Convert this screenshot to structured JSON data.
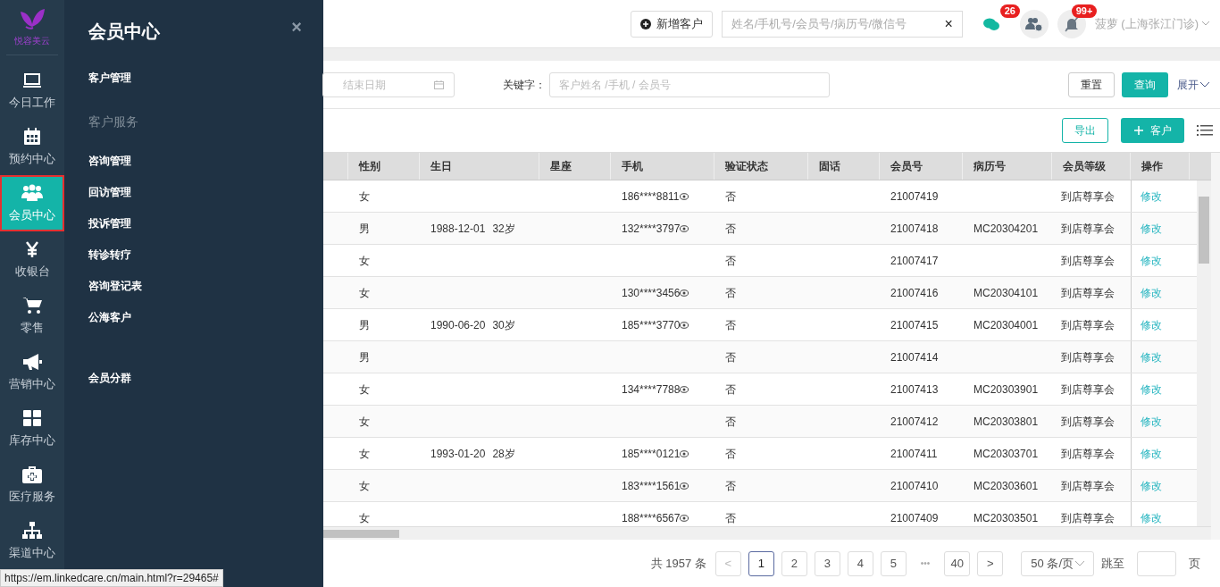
{
  "logo": {
    "text": "悦容美云"
  },
  "nav": [
    {
      "label": "今日工作",
      "selected": false
    },
    {
      "label": "预约中心",
      "selected": false
    },
    {
      "label": "会员中心",
      "selected": true
    },
    {
      "label": "收银台",
      "selected": false
    },
    {
      "label": "零售",
      "selected": false
    },
    {
      "label": "营销中心",
      "selected": false
    },
    {
      "label": "库存中心",
      "selected": false
    },
    {
      "label": "医疗服务",
      "selected": false
    },
    {
      "label": "渠道中心",
      "selected": false
    }
  ],
  "flyout": {
    "title": "会员中心",
    "close": "×",
    "items": [
      {
        "kind": "link",
        "label": "客户管理"
      },
      {
        "kind": "group",
        "label": "客户服务"
      },
      {
        "kind": "link",
        "label": "咨询管理"
      },
      {
        "kind": "link",
        "label": "回访管理"
      },
      {
        "kind": "link",
        "label": "投诉管理"
      },
      {
        "kind": "link",
        "label": "转诊转疗"
      },
      {
        "kind": "link",
        "label": "咨询登记表"
      },
      {
        "kind": "link",
        "label": "公海客户"
      },
      {
        "kind": "spacer"
      },
      {
        "kind": "link",
        "label": "会员分群"
      }
    ]
  },
  "header": {
    "add_button": "新增客户",
    "search": {
      "placeholder": "姓名/手机号/会员号/病历号/微信号",
      "clear": "×"
    },
    "wechat_badge": "26",
    "bell_badge": "99+",
    "user": "菠萝 (上海张江门诊)"
  },
  "filter": {
    "end_date_placeholder": "结束日期",
    "keyword_label": "关键字：",
    "keyword_placeholder": "客户姓名 /手机 / 会员号",
    "reset": "重置",
    "query": "查询",
    "expand": "展开"
  },
  "toolbar": {
    "export": "导出",
    "add": "客户"
  },
  "table": {
    "columns": [
      "性别",
      "生日",
      "星座",
      "手机",
      "验证状态",
      "固话",
      "会员号",
      "病历号",
      "会员等级",
      "操作"
    ],
    "rows": [
      {
        "gender": "女",
        "birthday": "",
        "age": "",
        "phone": "186****8811",
        "verified": "否",
        "member_no": "21007419",
        "record_no": "",
        "level": "到店尊享会",
        "action": "修改"
      },
      {
        "gender": "男",
        "birthday": "1988-12-01",
        "age": "32岁",
        "phone": "132****3797",
        "verified": "否",
        "member_no": "21007418",
        "record_no": "MC20304201",
        "level": "到店尊享会",
        "action": "修改"
      },
      {
        "gender": "女",
        "birthday": "",
        "age": "",
        "phone": "",
        "verified": "否",
        "member_no": "21007417",
        "record_no": "",
        "level": "到店尊享会",
        "action": "修改"
      },
      {
        "gender": "女",
        "birthday": "",
        "age": "",
        "phone": "130****3456",
        "verified": "否",
        "member_no": "21007416",
        "record_no": "MC20304101",
        "level": "到店尊享会",
        "action": "修改"
      },
      {
        "gender": "男",
        "birthday": "1990-06-20",
        "age": "30岁",
        "phone": "185****3770",
        "verified": "否",
        "member_no": "21007415",
        "record_no": "MC20304001",
        "level": "到店尊享会",
        "action": "修改"
      },
      {
        "gender": "男",
        "birthday": "",
        "age": "",
        "phone": "",
        "verified": "否",
        "member_no": "21007414",
        "record_no": "",
        "level": "到店尊享会",
        "action": "修改"
      },
      {
        "gender": "女",
        "birthday": "",
        "age": "",
        "phone": "134****7788",
        "verified": "否",
        "member_no": "21007413",
        "record_no": "MC20303901",
        "level": "到店尊享会",
        "action": "修改"
      },
      {
        "gender": "女",
        "birthday": "",
        "age": "",
        "phone": "",
        "verified": "否",
        "member_no": "21007412",
        "record_no": "MC20303801",
        "level": "到店尊享会",
        "action": "修改"
      },
      {
        "gender": "女",
        "birthday": "1993-01-20",
        "age": "28岁",
        "phone": "185****0121",
        "verified": "否",
        "member_no": "21007411",
        "record_no": "MC20303701",
        "level": "到店尊享会",
        "action": "修改"
      },
      {
        "gender": "女",
        "birthday": "",
        "age": "",
        "phone": "183****1561",
        "verified": "否",
        "member_no": "21007410",
        "record_no": "MC20303601",
        "level": "到店尊享会",
        "action": "修改"
      },
      {
        "gender": "女",
        "birthday": "",
        "age": "",
        "phone": "188****6567",
        "verified": "否",
        "member_no": "21007409",
        "record_no": "MC20303501",
        "level": "到店尊享会",
        "action": "修改"
      }
    ]
  },
  "pagination": {
    "total": "共 1957 条",
    "prev": "<",
    "pages": [
      {
        "label": "1",
        "selected": true
      },
      {
        "label": "2",
        "selected": false
      },
      {
        "label": "3",
        "selected": false
      },
      {
        "label": "4",
        "selected": false
      },
      {
        "label": "5",
        "selected": false
      }
    ],
    "ellipsis": "•••",
    "last": "40",
    "next": ">",
    "page_size": "50 条/页",
    "jump_label": "跳至",
    "page_unit": "页"
  },
  "status_url": "https://em.linkedcare.cn/main.html?r=29465#"
}
